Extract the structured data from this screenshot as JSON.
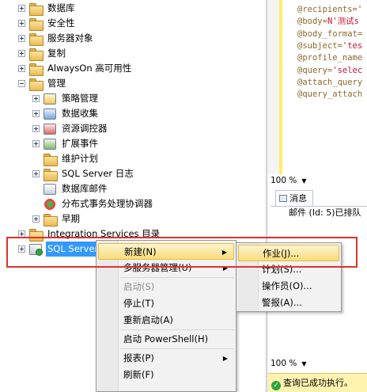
{
  "tree": {
    "items": [
      {
        "label": "数据库",
        "icon": "folder-icon",
        "expand": "plus"
      },
      {
        "label": "安全性",
        "icon": "folder-icon",
        "expand": "plus"
      },
      {
        "label": "服务器对象",
        "icon": "folder-icon",
        "expand": "plus"
      },
      {
        "label": "复制",
        "icon": "folder-icon",
        "expand": "plus"
      },
      {
        "label": "AlwaysOn 高可用性",
        "icon": "folder-icon",
        "expand": "plus"
      },
      {
        "label": "管理",
        "icon": "folder-icon",
        "expand": "minus"
      },
      {
        "label": "策略管理",
        "icon": "policy-icon",
        "expand": "plus"
      },
      {
        "label": "数据收集",
        "icon": "data-collection-icon",
        "expand": "plus"
      },
      {
        "label": "资源调控器",
        "icon": "resource-governor-icon",
        "expand": "plus"
      },
      {
        "label": "扩展事件",
        "icon": "extended-events-icon",
        "expand": "plus"
      },
      {
        "label": "维护计划",
        "icon": "folder-icon",
        "expand": "none"
      },
      {
        "label": "SQL Server 日志",
        "icon": "folder-icon",
        "expand": "plus"
      },
      {
        "label": "数据库邮件",
        "icon": "database-mail-icon",
        "expand": "none"
      },
      {
        "label": "分布式事务处理协调器",
        "icon": "dtc-icon",
        "expand": "none"
      },
      {
        "label": "早期",
        "icon": "folder-icon",
        "expand": "plus"
      },
      {
        "label": "Integration Services 目录",
        "icon": "folder-icon",
        "expand": "plus"
      },
      {
        "label": "SQL Server",
        "icon": "sql-agent-icon",
        "expand": "plus",
        "selected": true
      }
    ]
  },
  "editor": {
    "lines": [
      {
        "k": "@recipients=",
        "s": "'"
      },
      {
        "k": "@body=",
        "s": "N'测试s"
      },
      {
        "k": "@body_format=",
        "s": ""
      },
      {
        "k": "@subject=",
        "s": "'tes"
      },
      {
        "k": "@profile_name",
        "s": ""
      },
      {
        "k": "@query=",
        "s": "'selec"
      },
      {
        "k": "@attach_query",
        "s": ""
      },
      {
        "k": "@query_attach",
        "s": ""
      }
    ],
    "zoom_top": "100 %",
    "zoom_bottom": "100 %"
  },
  "messages": {
    "tab_label": "消息",
    "text": "邮件 (Id: 5)已排队"
  },
  "status": {
    "text": "查询已成功执行。"
  },
  "context_menu": {
    "items": [
      {
        "label": "新建(N)",
        "submenu": true,
        "highlighted": true
      },
      {
        "label": "多服务器管理(U)",
        "submenu": true
      },
      {
        "sep": true
      },
      {
        "label": "启动(S)",
        "disabled": true
      },
      {
        "label": "停止(T)"
      },
      {
        "label": "重新启动(A)"
      },
      {
        "sep": true
      },
      {
        "label": "启动 PowerShell(H)"
      },
      {
        "sep": true
      },
      {
        "label": "报表(P)",
        "submenu": true
      },
      {
        "label": "刷新(F)"
      }
    ]
  },
  "submenu": {
    "items": [
      {
        "label": "作业(J)...",
        "highlighted": true
      },
      {
        "label": "计划(S)..."
      },
      {
        "label": "操作员(O)..."
      },
      {
        "label": "警报(A)..."
      }
    ]
  },
  "colors": {
    "selection": "#3399ff",
    "menu_highlight": "#f9dc7a",
    "annotation": "#e0312b",
    "status_bar": "#fff3b0"
  }
}
